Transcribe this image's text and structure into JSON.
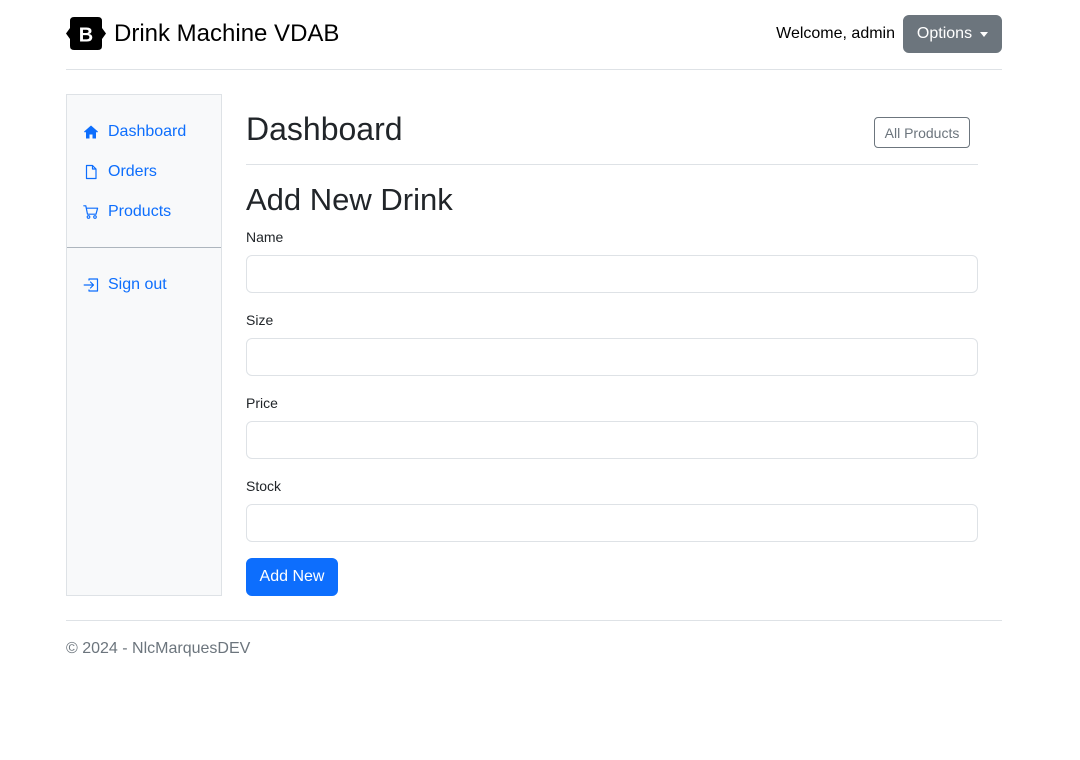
{
  "header": {
    "brand_title": "Drink Machine VDAB",
    "welcome_text": "Welcome, admin",
    "options_label": "Options"
  },
  "sidebar": {
    "items": [
      {
        "label": "Dashboard",
        "icon": "house-icon"
      },
      {
        "label": "Orders",
        "icon": "file-icon"
      },
      {
        "label": "Products",
        "icon": "cart-icon"
      }
    ],
    "sign_out": {
      "label": "Sign out",
      "icon": "box-arrow-in-icon"
    }
  },
  "main": {
    "title": "Dashboard",
    "all_products_label": "All Products",
    "section_title": "Add New Drink",
    "fields": [
      {
        "label": "Name",
        "value": ""
      },
      {
        "label": "Size",
        "value": ""
      },
      {
        "label": "Price",
        "value": ""
      },
      {
        "label": "Stock",
        "value": ""
      }
    ],
    "submit_label": "Add New"
  },
  "footer": {
    "text": "© 2024 - NlcMarquesDEV"
  },
  "colors": {
    "primary": "#0d6efd",
    "secondary": "#6c757d",
    "sidebar_bg": "#f8f9fa",
    "border": "#dee2e6"
  }
}
